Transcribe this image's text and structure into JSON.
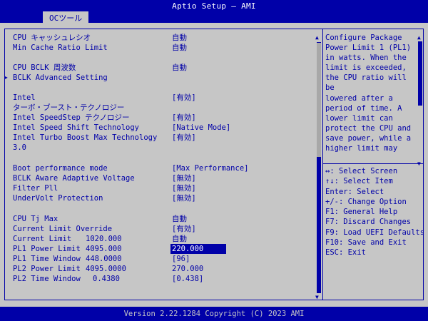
{
  "header": {
    "title": "Aptio Setup – AMI",
    "tab": "OCツール"
  },
  "settings": [
    {
      "label": "CPU キャッシュレシオ",
      "value": "自動",
      "top": 0
    },
    {
      "label": "Min Cache Ratio Limit",
      "value": "自動"
    },
    {
      "label": "CPU BCLK 周波数",
      "value": "自動"
    },
    {
      "label": "BCLK Advanced Setting",
      "value": ""
    },
    {
      "label": "Intel",
      "value": "[有効]"
    },
    {
      "label": "ターボ・ブースト・テクノロジー",
      "value": ""
    },
    {
      "label": "Intel SpeedStep テクノロジー",
      "value": "[有効]"
    },
    {
      "label": "Intel Speed Shift Technology",
      "value": "[Native Mode]"
    },
    {
      "label": "Intel Turbo Boost Max Technology",
      "value": "[有効]"
    },
    {
      "label": "3.0",
      "value": ""
    },
    {
      "label": "Boot performance mode",
      "value": "[Max Performance]"
    },
    {
      "label": "BCLK Aware Adaptive Voltage",
      "value": "[無効]"
    },
    {
      "label": "Filter Pll",
      "value": "[無効]"
    },
    {
      "label": "UnderVolt Protection",
      "value": "[無効]"
    },
    {
      "label": "CPU Tj Max",
      "value": "自動"
    },
    {
      "label": "Current Limit Override",
      "value": "[有効]"
    },
    {
      "label": "Current Limit",
      "number": "1020.000",
      "value": "自動"
    },
    {
      "label": "PL1 Power Limit",
      "number": "4095.000",
      "value": "220.000"
    },
    {
      "label": "PL1 Time Window",
      "number": "448.0000",
      "value": "[96]"
    },
    {
      "label": "PL2 Power Limit",
      "number": "4095.0000",
      "value": "270.000"
    },
    {
      "label": "PL2 Time Window",
      "number": "0.4380",
      "value": "[0.438]"
    }
  ],
  "submenu_marker": "▶",
  "help": {
    "lines": [
      "Configure Package",
      "Power Limit 1 (PL1)",
      "in watts. When the",
      "limit is exceeded,",
      "the CPU ratio will be",
      "lowered after a",
      "period of time. A",
      "lower limit can",
      "protect the CPU and",
      "save power, while a",
      "higher limit may"
    ]
  },
  "keys": [
    "↔: Select Screen",
    "↑↓: Select Item",
    "Enter: Select",
    "+/-: Change Option",
    "F1: General Help",
    "F7: Discard Changes",
    "F9: Load UEFI Defaults",
    "F10: Save and Exit",
    "ESC: Exit"
  ],
  "footer": "Version 2.22.1284 Copyright (C) 2023 AMI",
  "colors": {
    "accent": "#0000a8",
    "panel": "#c6c6c6",
    "highlight_text": "#ffffff"
  }
}
